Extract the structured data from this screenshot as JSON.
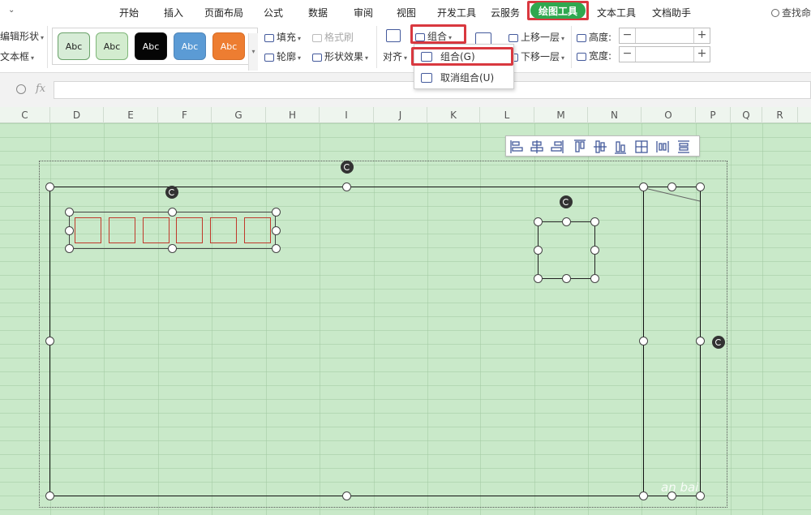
{
  "menubar": {
    "tabs": [
      "开始",
      "插入",
      "页面布局",
      "公式",
      "数据",
      "审阅",
      "视图",
      "开发工具",
      "云服务",
      "绘图工具",
      "文本工具",
      "文档助手"
    ],
    "active_tab": "绘图工具",
    "search_label": "查找命"
  },
  "ribbon": {
    "edit_shape": "编辑形状",
    "text_box": "文本框",
    "style_swatches": [
      {
        "label": "Abc",
        "bg": "#d7ecd7",
        "border": "#6aa26a",
        "color": "#222"
      },
      {
        "label": "Abc",
        "bg": "#d3eccf",
        "border": "#7fb679",
        "color": "#222"
      },
      {
        "label": "Abc",
        "bg": "#050505",
        "border": "#111111",
        "color": "#ffffff"
      },
      {
        "label": "Abc",
        "bg": "#5b9bd5",
        "border": "#4f86b9",
        "color": "#ffffff"
      },
      {
        "label": "Abc",
        "bg": "#ed7d31",
        "border": "#d96d25",
        "color": "#ffffff"
      }
    ],
    "fill": "填充",
    "format_painter": "格式刷",
    "outline": "轮廓",
    "shape_effect": "形状效果",
    "align": "对齐",
    "group": "组合",
    "bring_forward": "上移一层",
    "send_backward": "下移一层",
    "height_label": "高度:",
    "width_label": "宽度:",
    "height_value": "",
    "width_value": "",
    "minus": "−",
    "plus": "+"
  },
  "group_menu": {
    "items": [
      "组合(G)",
      "取消组合(U)"
    ]
  },
  "formula_bar": {
    "fx": "fx",
    "value": ""
  },
  "columns": [
    "C",
    "D",
    "E",
    "F",
    "G",
    "H",
    "I",
    "J",
    "K",
    "L",
    "M",
    "N",
    "O",
    "P",
    "Q",
    "R"
  ],
  "watermark": "an bai",
  "colors": {
    "highlight_red": "#d9383f",
    "active_tab_green": "#2fa84f",
    "sheet_green": "#c9e9c9"
  }
}
